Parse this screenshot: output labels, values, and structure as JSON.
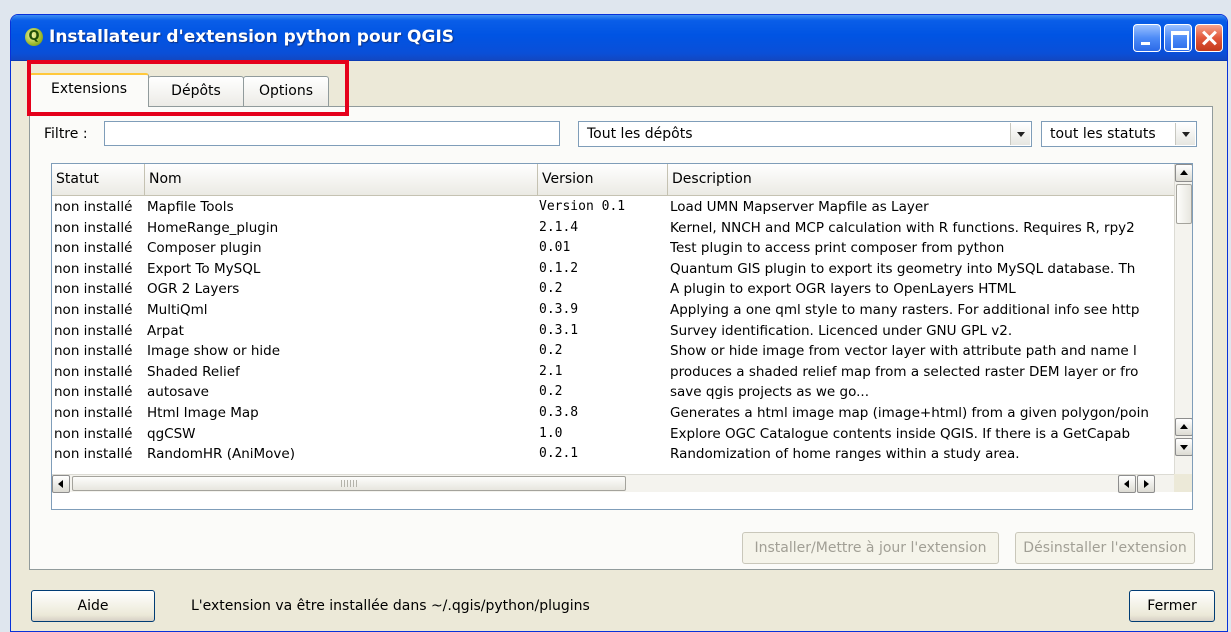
{
  "window": {
    "title": "Installateur d'extension python pour QGIS",
    "app_icon_glyph": "Q",
    "accent": "#0054e3"
  },
  "tabs": [
    {
      "label": "Extensions",
      "active": true
    },
    {
      "label": "Dépôts",
      "active": false
    },
    {
      "label": "Options",
      "active": false
    }
  ],
  "highlight_color": "#e5001b",
  "filter": {
    "label": "Filtre :",
    "value": "",
    "repo_selected": "Tout les dépôts",
    "status_selected": "tout les statuts"
  },
  "table": {
    "columns": [
      "Statut",
      "Nom",
      "Version",
      "Description"
    ],
    "rows": [
      {
        "statut": "non installé",
        "nom": "Mapfile Tools",
        "version": "Version 0.1",
        "description": "Load UMN Mapserver Mapfile as Layer"
      },
      {
        "statut": "non installé",
        "nom": "HomeRange_plugin",
        "version": "2.1.4",
        "description": "Kernel, NNCH and MCP calculation with R functions. Requires R, rpy2"
      },
      {
        "statut": "non installé",
        "nom": "Composer plugin",
        "version": "0.01",
        "description": "Test plugin to access print composer from python"
      },
      {
        "statut": "non installé",
        "nom": "Export To MySQL",
        "version": "0.1.2",
        "description": "Quantum GIS plugin to export its geometry into MySQL database. Th"
      },
      {
        "statut": "non installé",
        "nom": "OGR 2 Layers",
        "version": "0.2",
        "description": "A plugin to export OGR layers to OpenLayers HTML"
      },
      {
        "statut": "non installé",
        "nom": "MultiQml",
        "version": "0.3.9",
        "description": "Applying a one qml style to many rasters. For additional info see http"
      },
      {
        "statut": "non installé",
        "nom": "Arpat",
        "version": "0.3.1",
        "description": "Survey identification. Licenced under GNU GPL v2."
      },
      {
        "statut": "non installé",
        "nom": "Image show or hide",
        "version": "0.2",
        "description": "Show or hide image from vector layer with attribute path and name l"
      },
      {
        "statut": "non installé",
        "nom": "Shaded Relief",
        "version": "2.1",
        "description": "produces a shaded relief map from a selected raster DEM layer or fro"
      },
      {
        "statut": "non installé",
        "nom": "autosave",
        "version": "0.2",
        "description": "save qgis projects as we go..."
      },
      {
        "statut": "non installé",
        "nom": "Html Image Map",
        "version": "0.3.8",
        "description": "Generates a html image map (image+html) from a given polygon/poin"
      },
      {
        "statut": "non installé",
        "nom": "qgCSW",
        "version": "1.0",
        "description": "Explore OGC Catalogue contents inside QGIS. If there is a GetCapab"
      },
      {
        "statut": "non installé",
        "nom": "RandomHR (AniMove)",
        "version": "0.2.1",
        "description": "Randomization of home ranges within a study area."
      }
    ]
  },
  "buttons": {
    "install": "Installer/Mettre à jour l'extension",
    "uninstall": "Désinstaller l'extension",
    "help": "Aide",
    "close": "Fermer"
  },
  "status_message": "L'extension va être installée dans ~/.qgis/python/plugins"
}
